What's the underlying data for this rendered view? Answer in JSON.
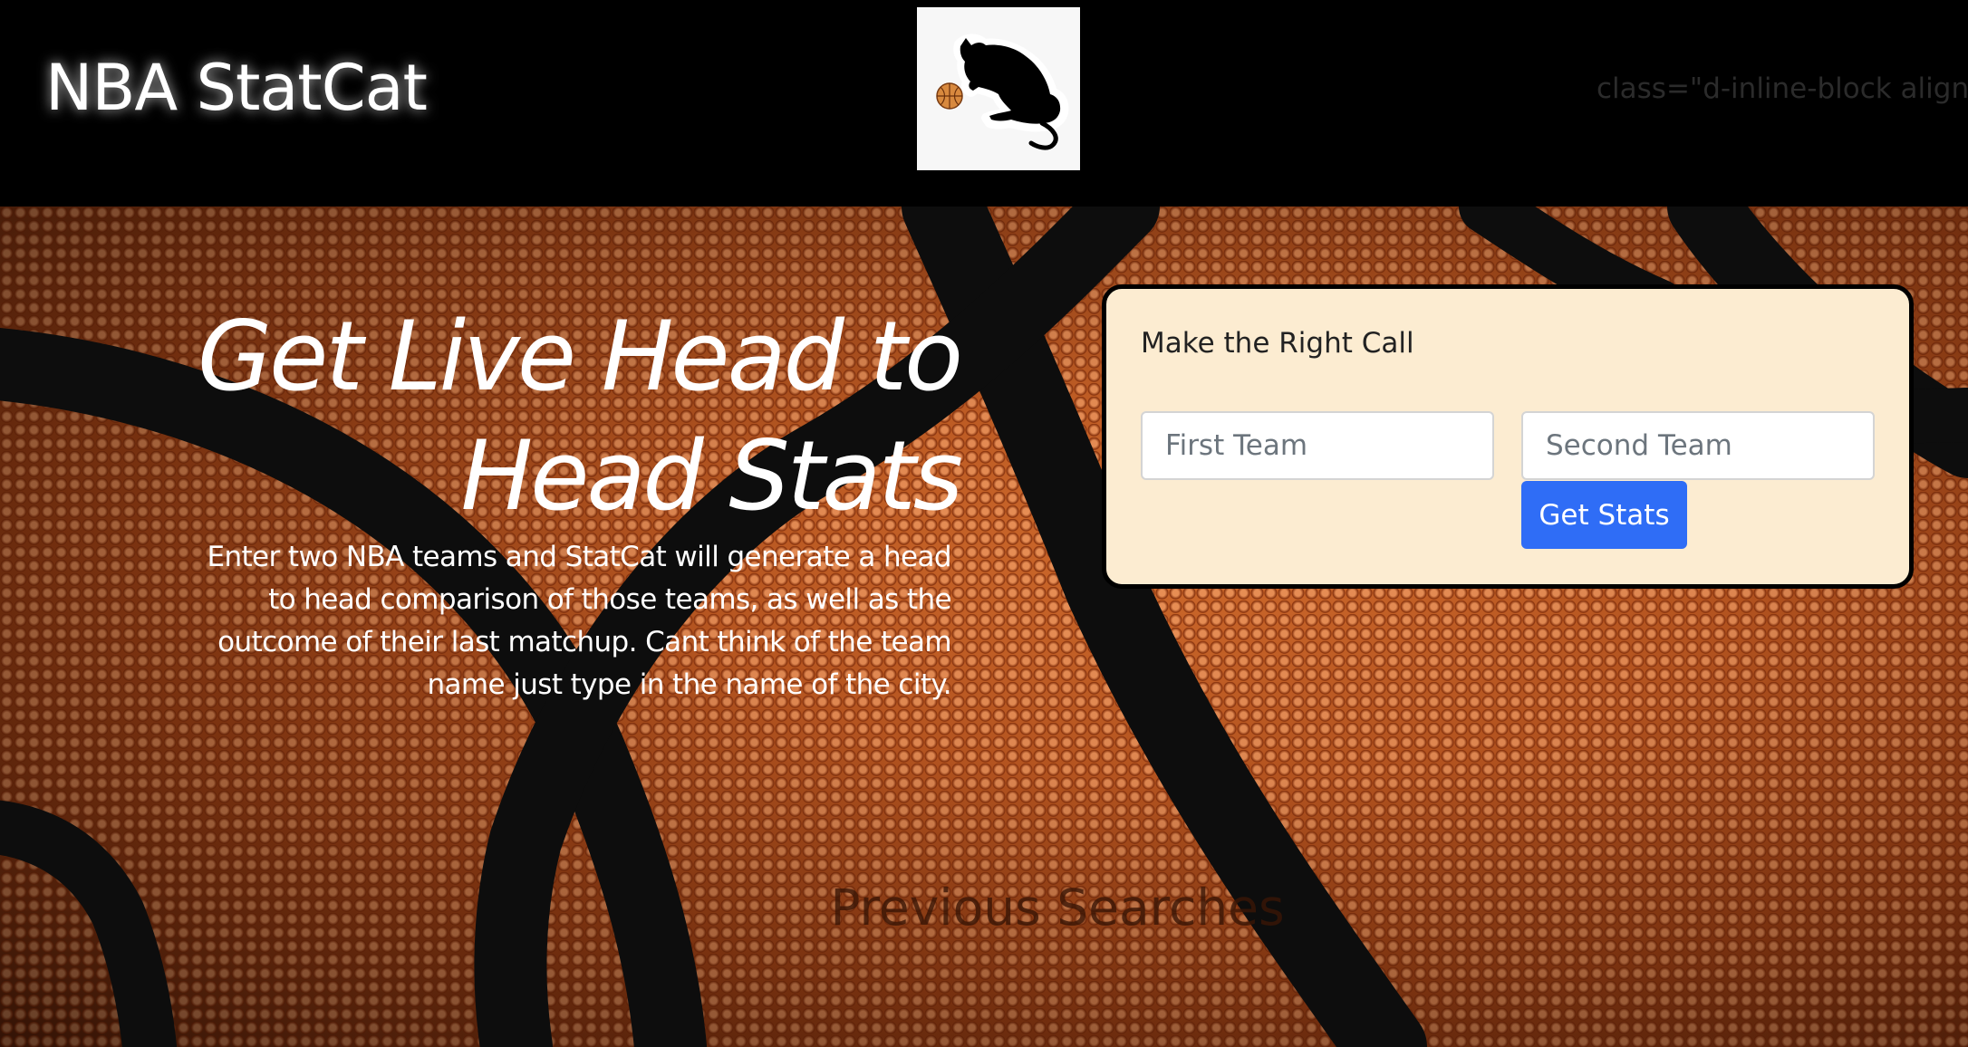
{
  "header": {
    "title": "NBA StatCat",
    "logo_icon": "cat-with-basketball-logo",
    "stray_text": "class=\"d-inline-block align-tex"
  },
  "hero": {
    "heading_line1": "Get Live Head to",
    "heading_line2": "Head Stats",
    "description": "Enter two NBA teams and StatCat will generate a head to head comparison of those teams, as well as the outcome of their last matchup. Cant think of the team name just type in the name of the city.",
    "background_icon": "basketball-texture"
  },
  "search_card": {
    "title": "Make the Right Call",
    "first_team": {
      "value": "",
      "placeholder": "First Team"
    },
    "second_team": {
      "value": "",
      "placeholder": "Second Team"
    },
    "button_label": "Get Stats",
    "button_color": "#2f6df6",
    "card_color": "#fcecd1"
  },
  "previous_searches": {
    "heading": "Previous Searches"
  }
}
